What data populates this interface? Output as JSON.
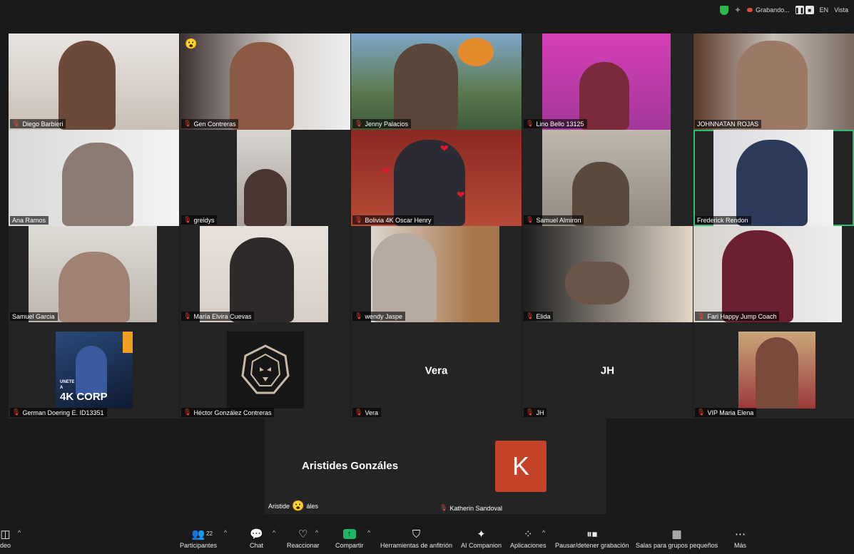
{
  "top": {
    "recording_label": "Grabando...",
    "language": "EN",
    "view_label": "Vista"
  },
  "tiles": [
    {
      "name": "Diego Barbieri"
    },
    {
      "name": "Gen Contreras"
    },
    {
      "name": "Jenny Palacios"
    },
    {
      "name": "Lino Bello 13125"
    },
    {
      "name": "JOHNNATAN ROJAS"
    },
    {
      "name": "Ana Ramos"
    },
    {
      "name": "greidys"
    },
    {
      "name": "Bolivia 4K Oscar Henry"
    },
    {
      "name": "Samuel Almiron"
    },
    {
      "name": "Frederick Rendon"
    },
    {
      "name": "Samuel Garcia"
    },
    {
      "name": "María Elvira Cuevas"
    },
    {
      "name": "wendy Jaspe"
    },
    {
      "name": "Elida"
    },
    {
      "name": "Fari Happy Jump Coach"
    },
    {
      "name": "German Doering E. ID13351"
    },
    {
      "name": "Héctor González Contreras"
    },
    {
      "name": "Vera",
      "center": "Vera"
    },
    {
      "name": "JH",
      "center": "JH"
    },
    {
      "name": "VIP Maria Elena"
    }
  ],
  "poster_text": {
    "line1": "UNETE",
    "line2": "A",
    "brand": "4K CORP"
  },
  "bottom": {
    "aristides_center": "Aristides Gonzáles",
    "aristides_label_a": "Aristide",
    "aristides_label_b": "áles",
    "katherin_initial": "K",
    "katherin_label": "Katherin Sandoval"
  },
  "toolbar": {
    "video": "deo",
    "participants": "Participantes",
    "participants_count": "22",
    "chat": "Chat",
    "react": "Reaccionar",
    "share": "Compartir",
    "host_tools": "Herramientas de anfitrión",
    "ai": "AI Companion",
    "apps": "Aplicaciones",
    "record": "Pausar/detener grabación",
    "rooms": "Salas para grupos pequeños",
    "more": "Más"
  },
  "colors": {
    "active_border": "#2fbf71",
    "avatar_k": "#c44228",
    "mic_muted": "#e3463a",
    "share": "#1db464"
  }
}
